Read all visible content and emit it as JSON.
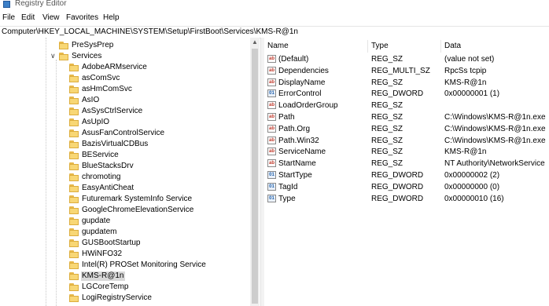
{
  "window": {
    "title": "Registry Editor"
  },
  "menu": [
    "File",
    "Edit",
    "View",
    "Favorites",
    "Help"
  ],
  "address": "Computer\\HKEY_LOCAL_MACHINE\\SYSTEM\\Setup\\FirstBoot\\Services\\KMS-R@1n",
  "tree": {
    "presysprep": "PreSysPrep",
    "services": "Services",
    "children": [
      "AdobeARMservice",
      "asComSvc",
      "asHmComSvc",
      "AsIO",
      "AsSysCtrlService",
      "AsUpIO",
      "AsusFanControlService",
      "BazisVirtualCDBus",
      "BEService",
      "BlueStacksDrv",
      "chromoting",
      "EasyAntiCheat",
      "Futuremark SystemInfo Service",
      "GoogleChromeElevationService",
      "gupdate",
      "gupdatem",
      "GUSBootStartup",
      "HWiNFO32",
      "Intel(R) PROSet Monitoring Service",
      "KMS-R@1n",
      "LGCoreTemp",
      "LogiRegistryService"
    ],
    "selected_index": 19
  },
  "values": {
    "columns": {
      "name": "Name",
      "type": "Type",
      "data": "Data"
    },
    "rows": [
      {
        "name": "(Default)",
        "type": "REG_SZ",
        "data": "(value not set)",
        "icon": "string-value-icon"
      },
      {
        "name": "Dependencies",
        "type": "REG_MULTI_SZ",
        "data": "RpcSs tcpip",
        "icon": "string-value-icon"
      },
      {
        "name": "DisplayName",
        "type": "REG_SZ",
        "data": "KMS-R@1n",
        "icon": "string-value-icon"
      },
      {
        "name": "ErrorControl",
        "type": "REG_DWORD",
        "data": "0x00000001 (1)",
        "icon": "dword-value-icon"
      },
      {
        "name": "LoadOrderGroup",
        "type": "REG_SZ",
        "data": "",
        "icon": "string-value-icon"
      },
      {
        "name": "Path",
        "type": "REG_SZ",
        "data": "C:\\Windows\\KMS-R@1n.exe",
        "icon": "string-value-icon"
      },
      {
        "name": "Path.Org",
        "type": "REG_SZ",
        "data": "C:\\Windows\\KMS-R@1n.exe",
        "icon": "string-value-icon"
      },
      {
        "name": "Path.Win32",
        "type": "REG_SZ",
        "data": "C:\\Windows\\KMS-R@1n.exe",
        "icon": "string-value-icon"
      },
      {
        "name": "ServiceName",
        "type": "REG_SZ",
        "data": "KMS-R@1n",
        "icon": "string-value-icon"
      },
      {
        "name": "StartName",
        "type": "REG_SZ",
        "data": "NT Authority\\NetworkService",
        "icon": "string-value-icon"
      },
      {
        "name": "StartType",
        "type": "REG_DWORD",
        "data": "0x00000002 (2)",
        "icon": "dword-value-icon"
      },
      {
        "name": "TagId",
        "type": "REG_DWORD",
        "data": "0x00000000 (0)",
        "icon": "dword-value-icon"
      },
      {
        "name": "Type",
        "type": "REG_DWORD",
        "data": "0x00000010 (16)",
        "icon": "dword-value-icon"
      }
    ]
  }
}
